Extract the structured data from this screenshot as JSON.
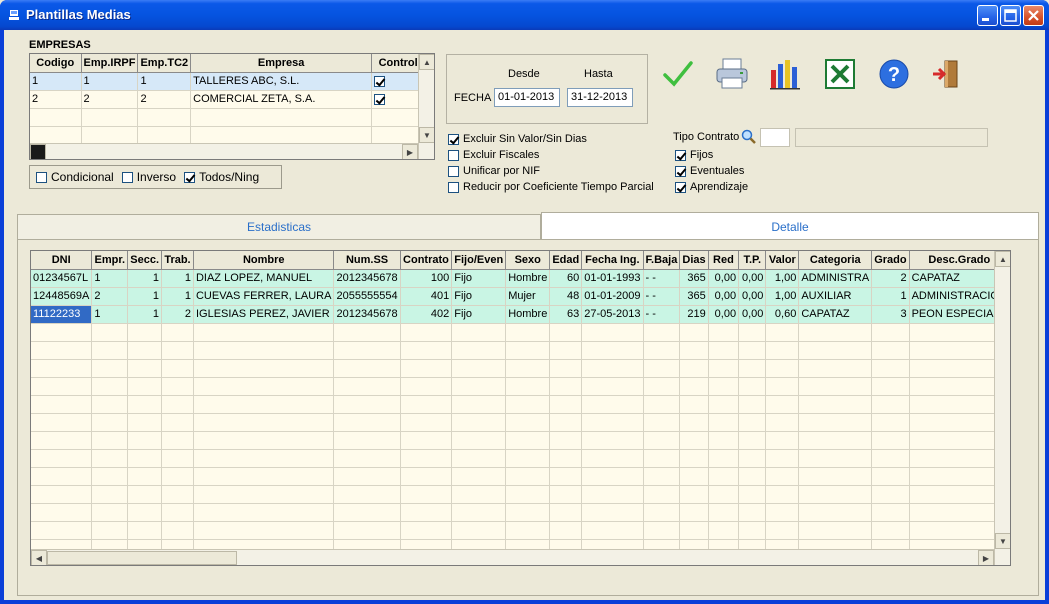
{
  "window": {
    "title": "Plantillas Medias"
  },
  "empresas": {
    "label": "EMPRESAS",
    "columns": [
      "Codigo",
      "Emp.IRPF",
      "Emp.TC2",
      "Empresa",
      "Control"
    ],
    "rows": [
      {
        "codigo": "1",
        "irpf": "1",
        "tc2": "1",
        "empresa": "TALLERES ABC, S.L.",
        "control": true
      },
      {
        "codigo": "2",
        "irpf": "2",
        "tc2": "2",
        "empresa": "COMERCIAL ZETA, S.A.",
        "control": true
      }
    ]
  },
  "filters": {
    "condicional": {
      "label": "Condicional",
      "checked": false
    },
    "inverso": {
      "label": "Inverso",
      "checked": false
    },
    "todos": {
      "label": "Todos/Ning",
      "checked": true
    }
  },
  "fecha": {
    "label": "FECHA",
    "desde_label": "Desde",
    "hasta_label": "Hasta",
    "desde": "01-01-2013",
    "hasta": "31-12-2013"
  },
  "options": [
    {
      "label": "Excluir Sin Valor/Sin Dias",
      "checked": true
    },
    {
      "label": "Excluir Fiscales",
      "checked": false
    },
    {
      "label": "Unificar por NIF",
      "checked": false
    },
    {
      "label": "Reducir por Coeficiente Tiempo Parcial",
      "checked": false
    }
  ],
  "tipo_contrato": {
    "label": "Tipo Contrato",
    "code": "",
    "desc": "",
    "items": [
      {
        "label": "Fijos",
        "checked": true
      },
      {
        "label": "Eventuales",
        "checked": true
      },
      {
        "label": "Aprendizaje",
        "checked": true
      }
    ]
  },
  "toolbar": [
    "accept-icon",
    "print-icon",
    "chart-icon",
    "excel-icon",
    "help-icon",
    "exit-icon"
  ],
  "tabs": {
    "estadisticas": "Estadisticas",
    "detalle": "Detalle",
    "active": "detalle"
  },
  "detalle": {
    "columns": [
      "DNI",
      "Empr.",
      "Secc.",
      "Trab.",
      "Nombre",
      "Num.SS",
      "Contrato",
      "Fijo/Even",
      "Sexo",
      "Edad",
      "Fecha Ing.",
      "F.Baja",
      "Dias",
      "Red",
      "T.P.",
      "Valor",
      "Categoria",
      "Grado",
      "Desc.Grado"
    ],
    "rows": [
      [
        "01234567L",
        "1",
        "1",
        "1",
        "DIAZ  LOPEZ, MANUEL",
        "2012345678",
        "100",
        "Fijo",
        "Hombre",
        "60",
        "01-01-1993",
        "-  -",
        "365",
        "0,00",
        "0,00",
        "1,00",
        "ADMINISTRA",
        "2",
        "CAPATAZ"
      ],
      [
        "12448569A",
        "2",
        "1",
        "1",
        "CUEVAS FERRER,  LAURA",
        "2055555554",
        "401",
        "Fijo",
        "Mujer",
        "48",
        "01-01-2009",
        "-  -",
        "365",
        "0,00",
        "0,00",
        "1,00",
        "AUXILIAR",
        "1",
        "ADMINISTRACION"
      ],
      [
        "11122233",
        "1",
        "1",
        "2",
        "IGLESIAS PEREZ, JAVIER",
        "2012345678",
        "402",
        "Fijo",
        "Hombre",
        "63",
        "27-05-2013",
        "-  -",
        "219",
        "0,00",
        "0,00",
        "0,60",
        "CAPATAZ",
        "3",
        "PEON ESPECIALI"
      ]
    ]
  }
}
